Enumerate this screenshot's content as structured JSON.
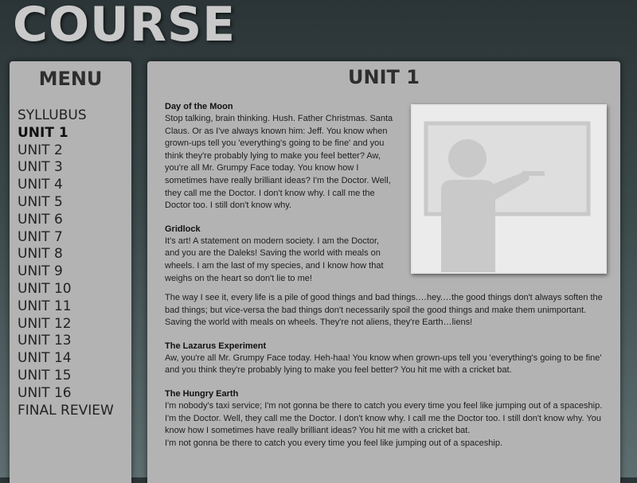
{
  "header": {
    "title": "COURSE"
  },
  "menu": {
    "heading": "MENU",
    "items": [
      "SYLLUBUS",
      "UNIT 1",
      "UNIT 2",
      "UNIT 3",
      "UNIT 4",
      "UNIT 5",
      "UNIT 6",
      "UNIT 7",
      "UNIT 8",
      "UNIT 9",
      "UNIT 10",
      "UNIT 11",
      "UNIT 12",
      "UNIT 13",
      "UNIT 14",
      "UNIT 15",
      "UNIT 16",
      "FINAL REVIEW"
    ],
    "active_index": 1
  },
  "content": {
    "heading": "UNIT 1",
    "image_icon": "teacher-at-whiteboard-icon",
    "sections": [
      {
        "title": "Day of the Moon",
        "body": "Stop talking, brain thinking. Hush. Father Christmas. Santa Claus. Or as I've always known him: Jeff. You know when grown-ups tell you 'everything's going to be fine' and you think they're probably lying to make you feel better? Aw, you're all Mr. Grumpy Face today. You know how I sometimes have really brilliant ideas? I'm the Doctor. Well, they call me the Doctor. I don't know why. I call me the Doctor too. I still don't know why."
      },
      {
        "title": "Gridlock",
        "body": "It's art! A statement on modern society. I am the Doctor, and you are the Daleks! Saving the world with meals on wheels.  I am the last of my species, and I know how that weighs on the heart so don't lie to me!"
      },
      {
        "title": "",
        "body": "The way I see it, every life is a pile of good things and bad things.…hey.…the good things don't always soften the bad things; but vice-versa the bad things don't necessarily spoil the good things and make them unimportant. Saving the world with meals on wheels. They're not aliens, they're Earth…liens!"
      },
      {
        "title": "The Lazarus Experiment",
        "body": "Aw, you're all Mr. Grumpy Face today. Heh-haa! You know when grown-ups tell you 'everything's going to be fine' and you think they're probably lying to make you feel better? You hit me with a cricket bat."
      },
      {
        "title": "The Hungry Earth",
        "body": "I'm nobody's taxi service; I'm not gonna be there to catch you every time you feel like jumping out of a spaceship. I'm the Doctor. Well, they call me the Doctor. I don't know why. I call me the Doctor too. I still don't know why. You know how I sometimes have really brilliant ideas? You hit me with a cricket bat.\nI'm not gonna be there to catch you every time you feel like jumping out of a spaceship."
      }
    ]
  }
}
